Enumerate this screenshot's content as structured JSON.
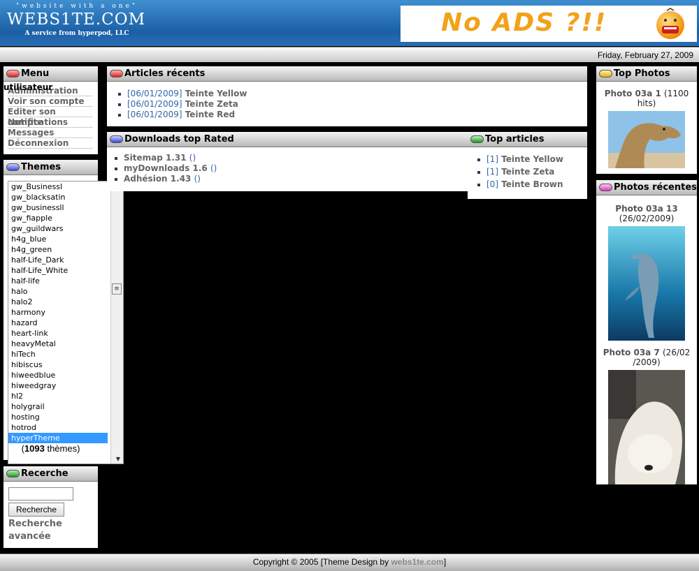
{
  "logo": {
    "tagline": "\"website with a one\"",
    "name": "WEBS1TE.COM",
    "subtitle": "A service from hyperpod, LLC"
  },
  "banner": {
    "text": "No ADS ?!!"
  },
  "date": "Friday, February 27, 2009",
  "menu": {
    "title": "Menu",
    "user_label": "utilisateur",
    "items": [
      "Administration",
      "Voir son compte",
      "Editer son compte",
      "Notifications",
      "Messages",
      "Déconnexion"
    ]
  },
  "themes": {
    "title": "Themes",
    "options": [
      "gw_Businessl",
      "gw_blacksatin",
      "gw_businessll",
      "gw_fiapple",
      "gw_guildwars",
      "h4g_blue",
      "h4g_green",
      "half-Life_Dark",
      "half-Life_White",
      "half-life",
      "halo",
      "halo2",
      "harmony",
      "hazard",
      "heart-link",
      "heavyMetal",
      "hiTech",
      "hibiscus",
      "hiweedblue",
      "hiweedgray",
      "hl2",
      "holygrail",
      "hosting",
      "hotrod",
      "hyperTheme"
    ],
    "selected": "hyperTheme",
    "count_prefix": "(",
    "count": "1093",
    "count_suffix": " thèmes)"
  },
  "search": {
    "title": "Recerche",
    "button": "Recherche",
    "advanced": "Recherche avancée"
  },
  "articles": {
    "title": "Articles récents",
    "items": [
      {
        "date": "[06/01/2009]",
        "title": "Teinte Yellow"
      },
      {
        "date": "[06/01/2009]",
        "title": "Teinte Zeta"
      },
      {
        "date": "[06/01/2009]",
        "title": "Teinte Red"
      }
    ]
  },
  "downloads": {
    "title": "Downloads top Rated",
    "items": [
      {
        "name": "Sitemap 1.31",
        "extra": "()"
      },
      {
        "name": "myDownloads 1.6",
        "extra": "()"
      },
      {
        "name": "Adhésion 1.43",
        "extra": "()"
      }
    ]
  },
  "top_articles": {
    "title": "Top articles",
    "items": [
      {
        "rank": "[1]",
        "title": "Teinte Yellow"
      },
      {
        "rank": "[1]",
        "title": "Teinte Zeta"
      },
      {
        "rank": "[0]",
        "title": "Teinte Brown"
      }
    ]
  },
  "top_photos": {
    "title": "Top Photos",
    "items": [
      {
        "name": "Photo 03a 1",
        "info": "(1100 hits)"
      }
    ]
  },
  "recent_photos": {
    "title": "Photos récentes",
    "items": [
      {
        "name": "Photo 03a 13",
        "info": "(26/02/2009)"
      },
      {
        "name": "Photo 03a 7",
        "info": "(26/02 /2009)"
      }
    ]
  },
  "footer": {
    "prefix": "Copyright © 2005 [Theme Design by ",
    "link": "webs1te.com",
    "suffix": "]"
  }
}
